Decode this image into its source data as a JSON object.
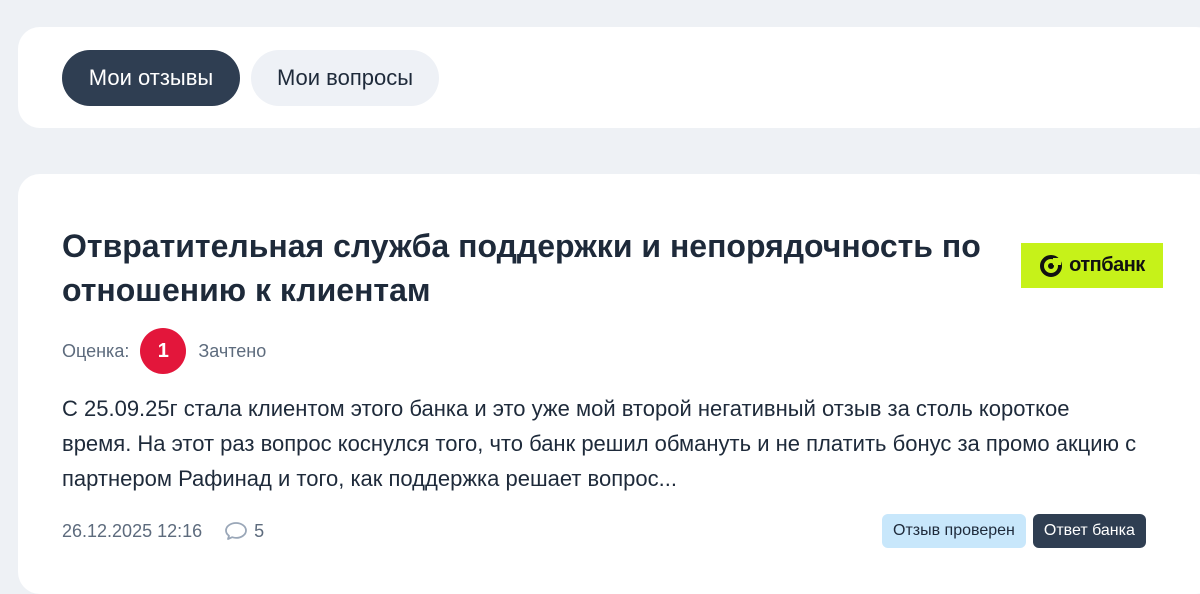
{
  "tabs": {
    "my_reviews": "Мои отзывы",
    "my_questions": "Мои вопросы"
  },
  "review": {
    "title": "Отвратительная служба поддержки и непорядочность по отношению к клиентам",
    "bank_logo_text": "отпбанк",
    "rating_label": "Оценка:",
    "rating_value": "1",
    "rating_status": "Зачтено",
    "excerpt": "С 25.09.25г стала клиентом этого банка и это уже мой второй негативный отзыв за столь короткое время. На этот раз вопрос коснулся того, что банк решил обмануть и не платить бонус за промо акцию с партнером Рафинад и того, как поддержка решает вопрос...",
    "date": "26.12.2025 12:16",
    "comments_count": "5",
    "badge_verified": "Отзыв проверен",
    "badge_bank_reply": "Ответ банка"
  },
  "colors": {
    "page_bg": "#eef1f5",
    "card_bg": "#ffffff",
    "active_tab": "#2f3e52",
    "inactive_tab": "#eef1f6",
    "rating_red": "#e3163b",
    "logo_green": "#c6f219",
    "verified_badge": "#c8e7fb"
  },
  "icons": {
    "bank_logo": "otp-logo-icon",
    "comments": "comment-bubble-icon"
  }
}
